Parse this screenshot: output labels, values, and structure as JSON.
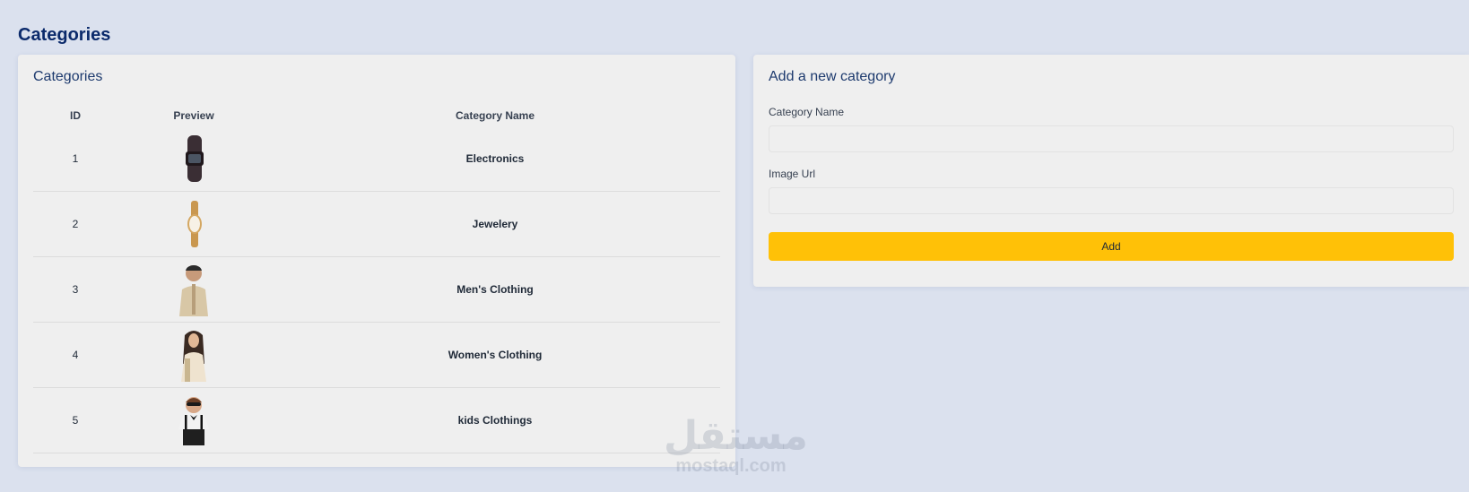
{
  "page": {
    "title": "Categories"
  },
  "list_card": {
    "title": "Categories",
    "columns": [
      "ID",
      "Preview",
      "Category Name"
    ],
    "rows": [
      {
        "id": "1",
        "preview": "watch-band-image",
        "name": "Electronics"
      },
      {
        "id": "2",
        "preview": "gold-watch-image",
        "name": "Jewelery"
      },
      {
        "id": "3",
        "preview": "man-shirt-image",
        "name": "Men's Clothing"
      },
      {
        "id": "4",
        "preview": "woman-image",
        "name": "Women's Clothing"
      },
      {
        "id": "5",
        "preview": "kid-image",
        "name": "kids Clothings"
      }
    ]
  },
  "form_card": {
    "title": "Add a new category",
    "name_label": "Category Name",
    "name_value": "",
    "url_label": "Image Url",
    "url_value": "",
    "add_label": "Add"
  },
  "watermark": {
    "arabic": "مستقل",
    "latin": "mostaql.com"
  },
  "colors": {
    "accent": "#ffc107",
    "title": "#0b2a6b",
    "background": "#dbe1ee",
    "card": "#efefef"
  }
}
